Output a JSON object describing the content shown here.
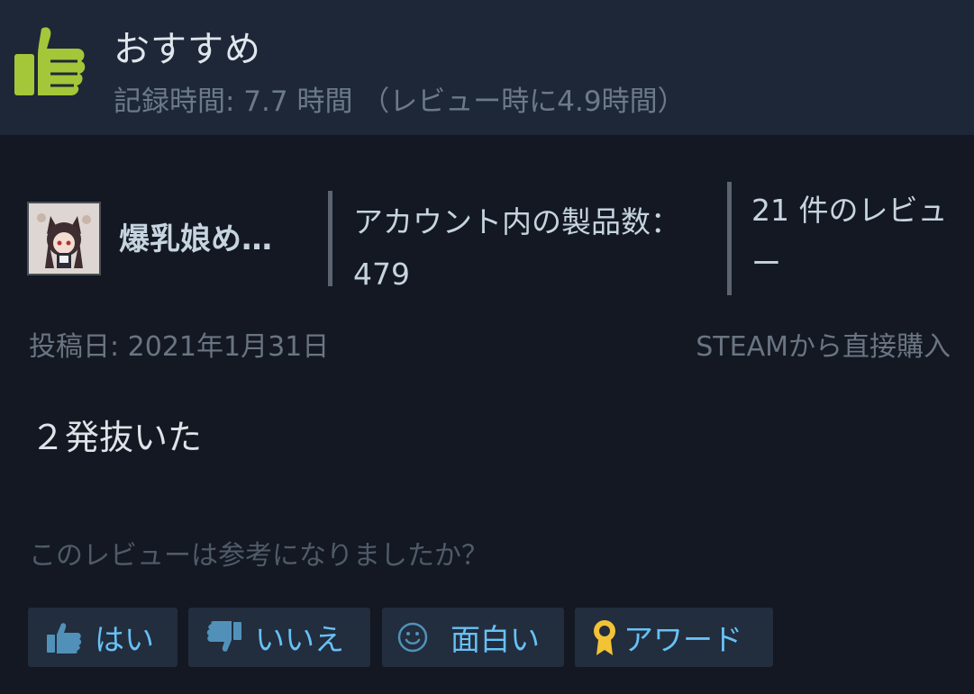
{
  "header": {
    "recommendation": "おすすめ",
    "hours": "記録時間: 7.7 時間 （レビュー時に4.9時間）",
    "thumb_color": "#a4c639"
  },
  "author": {
    "name": "爆乳娘め…",
    "products_label": "アカウント内の製品数： 479",
    "reviews_label": "21 件のレビュー"
  },
  "meta": {
    "posted": "投稿日: 2021年1月31日",
    "purchase": "STEAMから直接購入"
  },
  "review": {
    "text": "２発抜いた"
  },
  "helpful": {
    "question": "このレビューは参考になりましたか？",
    "yes": "はい",
    "no": "いいえ",
    "funny": "面白い",
    "award": "アワード"
  },
  "colors": {
    "button_text": "#67c1f5",
    "button_bg": "#222d3e",
    "award_icon": "#f2c335"
  }
}
